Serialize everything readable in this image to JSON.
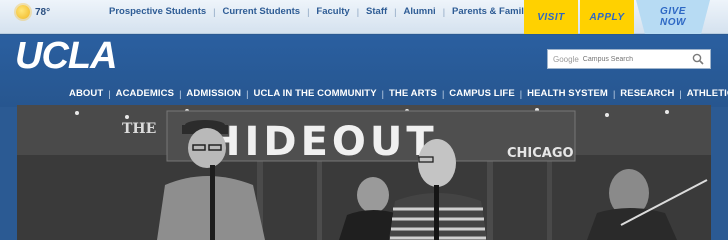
{
  "weather": {
    "icon": "sun-icon",
    "temperature": "78°"
  },
  "audience_links": [
    "Prospective Students",
    "Current Students",
    "Faculty",
    "Staff",
    "Alumni",
    "Parents & Families"
  ],
  "cta": {
    "visit": "VISIT",
    "apply": "APPLY",
    "give_line1": "GIVE",
    "give_line2": "NOW"
  },
  "logo": "UCLA",
  "search": {
    "brand": "Google",
    "placeholder": "Campus Search"
  },
  "main_nav": [
    "ABOUT",
    "ACADEMICS",
    "ADMISSION",
    "UCLA IN THE COMMUNITY",
    "THE ARTS",
    "CAMPUS LIFE",
    "HEALTH SYSTEM",
    "RESEARCH",
    "ATHLETICS"
  ],
  "hero": {
    "sign_text": "HIDEOUT",
    "sign_sub": "CHICAGO",
    "sign_left": "THE"
  },
  "colors": {
    "header_blue": "#2a5fa0",
    "gold": "#ffd100",
    "light_blue": "#b7dbf3"
  }
}
